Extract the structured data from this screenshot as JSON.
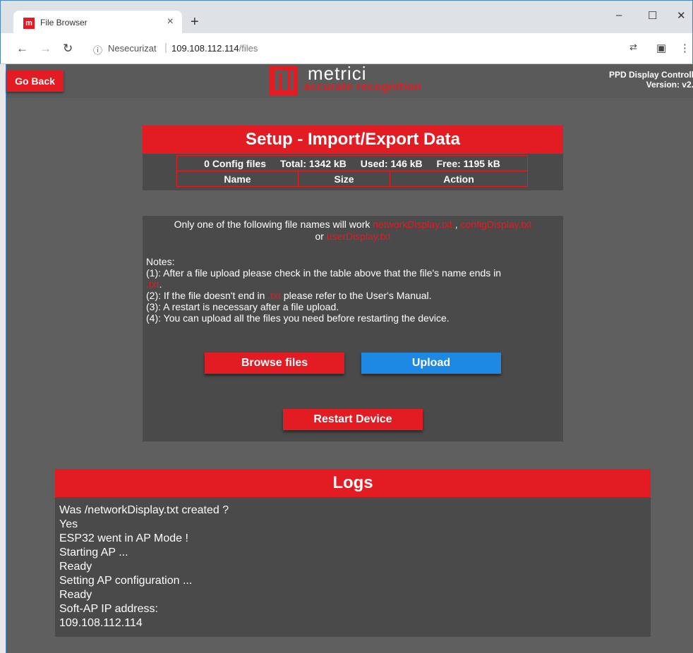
{
  "browser": {
    "tab_title": "File Browser",
    "tab_favicon": "m",
    "security_label": "Nesecurizat",
    "url_host": "109.108.112.114",
    "url_path": "/files"
  },
  "header": {
    "go_back_label": "Go Back",
    "logo_name": "metrici",
    "logo_tagline": "accurate recognition",
    "device_title": "PPD Display Controlle",
    "device_version": "Version: v2."
  },
  "setup": {
    "title": "Setup - Import/Export Data",
    "stats": {
      "config_files": "0 Config files",
      "total": "Total: 1342 kB",
      "used": "Used: 146 kB",
      "free": "Free: 1195 kB"
    },
    "columns": [
      "Name",
      "Size",
      "Action"
    ]
  },
  "upload": {
    "intro_prefix": "Only one of the following file names will work ",
    "file1": "networkDisplay.txt",
    "sep1": " , ",
    "file2": "configDisplay.txt",
    "or": "or ",
    "file3": "userDisplay.txt",
    "notes_title": "Notes:",
    "note1_text": "(1): After a file upload please check in the table above that the file's name ends in",
    "note1_ext": ".txt",
    "note1_end": ".",
    "note2_prefix": "(2): If the file doesn't end in ",
    "note2_ext": ".txt",
    "note2_suffix": " please refer to the User's Manual.",
    "note3": "(3): A restart is necessary after a file upload.",
    "note4": "(4): You can upload all the files you need before restarting the device.",
    "browse_label": "Browse files",
    "upload_label": "Upload",
    "restart_label": "Restart Device"
  },
  "logs": {
    "title": "Logs",
    "lines": [
      "Was /networkDisplay.txt created ?",
      "Yes",
      "ESP32 went in AP Mode !",
      "Starting AP ...",
      "Ready",
      "Setting AP configuration ...",
      "Ready",
      "Soft-AP IP address:",
      "109.108.112.114"
    ]
  },
  "colors": {
    "brand_red": "#e31b23",
    "upload_blue": "#1e88e5",
    "page_bg": "#5f5f5f",
    "panel_bg": "#4a4a4a"
  },
  "icons": {
    "back": "arrow-left-icon",
    "forward": "arrow-right-icon",
    "reload": "reload-icon",
    "info": "info-icon",
    "translate": "translate-icon",
    "profile": "profile-icon",
    "menu": "kebab-menu-icon"
  }
}
